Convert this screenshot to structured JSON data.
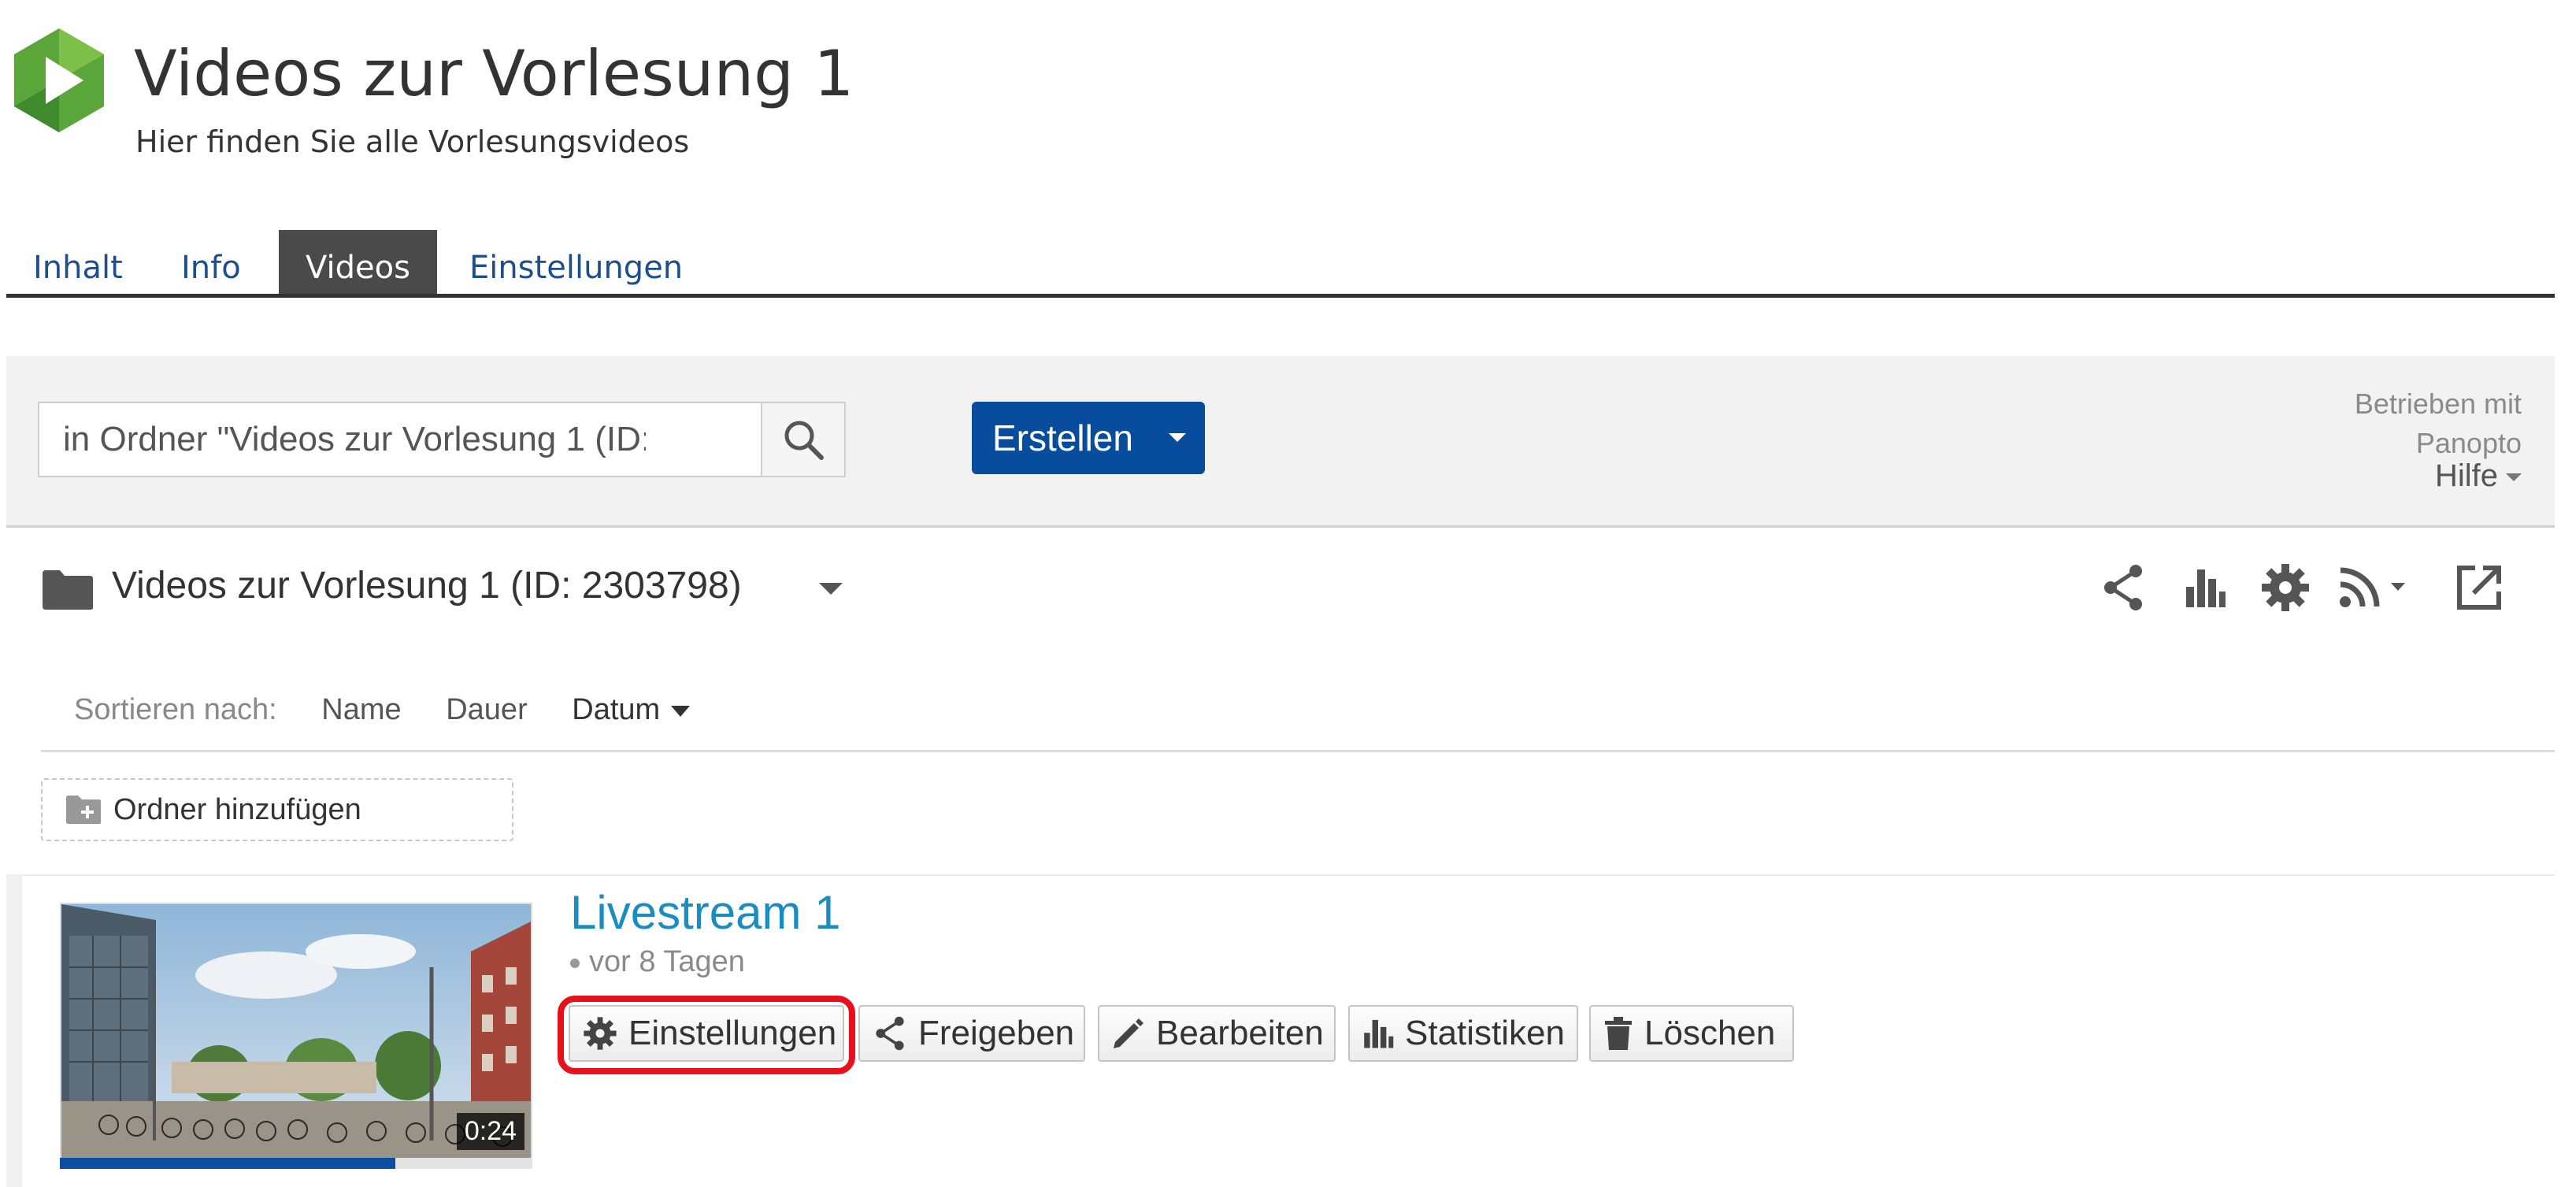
{
  "header": {
    "title": "Videos zur Vorlesung 1",
    "subtitle": "Hier finden Sie alle Vorlesungsvideos"
  },
  "tabs": [
    {
      "label": "Inhalt",
      "active": false
    },
    {
      "label": "Info",
      "active": false
    },
    {
      "label": "Videos",
      "active": true
    },
    {
      "label": "Einstellungen",
      "active": false
    }
  ],
  "toolbar": {
    "search_placeholder": "in Ordner \"Videos zur Vorlesung 1 (ID:…",
    "create_label": "Erstellen",
    "powered_line1": "Betrieben mit",
    "powered_line2": "Panopto",
    "help_label": "Hilfe"
  },
  "folder": {
    "title": "Videos zur Vorlesung 1 (ID: 2303798)",
    "icons": [
      "share-icon",
      "stats-icon",
      "gear-icon",
      "rss-icon",
      "external-link-icon"
    ]
  },
  "sort": {
    "label": "Sortieren nach:",
    "name": "Name",
    "duration": "Dauer",
    "date": "Datum"
  },
  "add_folder_label": "Ordner hinzufügen",
  "session": {
    "title": "Livestream 1",
    "meta": "vor 8 Tagen",
    "duration": "0:24",
    "progress_fraction": 0.71,
    "actions": [
      {
        "label": "Einstellungen",
        "icon": "gear-icon"
      },
      {
        "label": "Freigeben",
        "icon": "share-icon"
      },
      {
        "label": "Bearbeiten",
        "icon": "pencil-icon"
      },
      {
        "label": "Statistiken",
        "icon": "stats-icon"
      },
      {
        "label": "Löschen",
        "icon": "trash-icon"
      }
    ],
    "highlighted_action": "Einstellungen"
  },
  "colors": {
    "accent": "#084c9e",
    "link": "#1a8cc0",
    "highlight": "#e8101a",
    "logo_green": "#5aa63a"
  }
}
